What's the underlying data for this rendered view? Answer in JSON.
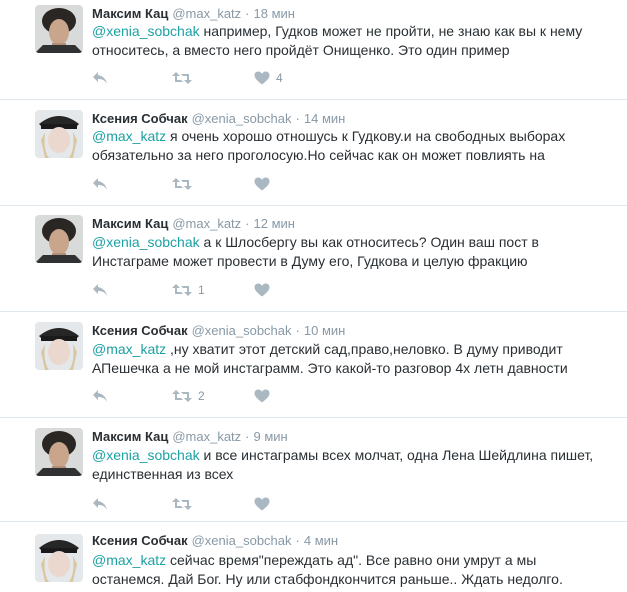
{
  "tweets": [
    {
      "author": "Максим Кац",
      "handle": "@max_katz",
      "time": "18 мин",
      "mention": "@xenia_sobchak",
      "text": " например, Гудков может не пройти, не знаю как вы к нему относитесь, а вместо него пройдёт Онищенко. Это один пример",
      "retweets": "",
      "likes": "4"
    },
    {
      "author": "Ксения Собчак",
      "handle": "@xenia_sobchak",
      "time": "14 мин",
      "mention": "@max_katz",
      "text": " я очень хорошо отношусь к Гудкову.и на свободных выборах обязательно за него проголосую.Но сейчас как он может повлиять на",
      "retweets": "",
      "likes": ""
    },
    {
      "author": "Максим Кац",
      "handle": "@max_katz",
      "time": "12 мин",
      "mention": "@xenia_sobchak",
      "text": " а к Шлосбергу вы как относитесь? Один ваш пост в Инстаграме может провести в Думу его, Гудкова и целую фракцию",
      "retweets": "1",
      "likes": ""
    },
    {
      "author": "Ксения Собчак",
      "handle": "@xenia_sobchak",
      "time": "10 мин",
      "mention": "@max_katz",
      "text": " ,ну хватит этот детский сад,право,неловко. В думу приводит АПешечка а не мой инстаграмм. Это какой-то разговор 4х летн давности",
      "retweets": "2",
      "likes": ""
    },
    {
      "author": "Максим Кац",
      "handle": "@max_katz",
      "time": "9 мин",
      "mention": "@xenia_sobchak",
      "text": " и все инстаграмы всех молчат, одна Лена Шейдлина пишет, единственная из всех",
      "retweets": "",
      "likes": ""
    },
    {
      "author": "Ксения Собчак",
      "handle": "@xenia_sobchak",
      "time": "4 мин",
      "mention": "@max_katz",
      "text": " сейчас время\"переждать ад\". Все равно они умрут а мы останемся. Дай Бог. Ну или стабфондкончится раньше.. Ждать недолго.",
      "retweets": "",
      "likes": ""
    }
  ],
  "icons": {
    "reply": "reply-icon",
    "retweet": "retweet-icon",
    "like": "heart-icon"
  },
  "colors": {
    "mention": "#1da1a4",
    "meta": "#8899a6",
    "icon": "#aab8c2",
    "divider": "#e1e8ed"
  }
}
